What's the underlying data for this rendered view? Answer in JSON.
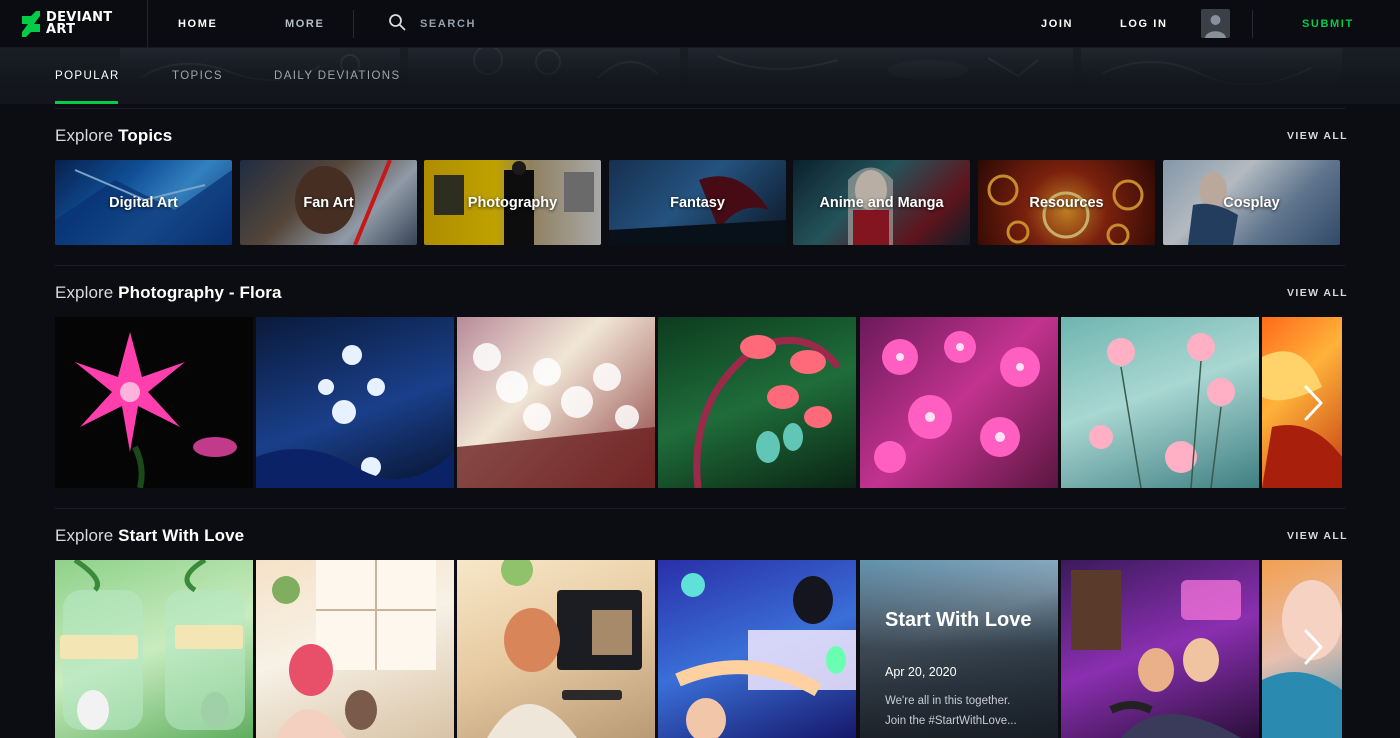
{
  "brand": {
    "name_line1": "DEVIANT",
    "name_line2": "ART",
    "accent": "#05cc47"
  },
  "nav": {
    "home": "HOME",
    "more": "MORE",
    "search_placeholder": "SEARCH",
    "join": "JOIN",
    "login": "LOG IN",
    "submit": "SUBMIT",
    "icons": [
      "search-icon",
      "avatar-icon"
    ]
  },
  "tabs": [
    {
      "label": "POPULAR",
      "active": true
    },
    {
      "label": "TOPICS",
      "active": false
    },
    {
      "label": "DAILY DEVIATIONS",
      "active": false
    }
  ],
  "sections": {
    "topics": {
      "prefix": "Explore ",
      "title": "Topics",
      "view_all": "VIEW ALL",
      "items": [
        "Digital Art",
        "Fan Art",
        "Photography",
        "Fantasy",
        "Anime and Manga",
        "Resources",
        "Cosplay"
      ]
    },
    "flora": {
      "prefix": "Explore ",
      "title": "Photography - Flora",
      "view_all": "VIEW ALL"
    },
    "love": {
      "prefix": "Explore ",
      "title": "Start With Love",
      "view_all": "VIEW ALL",
      "feature": {
        "title": "Start With Love",
        "date": "Apr 20, 2020",
        "desc_line1": "We're all in this together.",
        "desc_line2": "Join the #StartWithLove..."
      }
    }
  }
}
